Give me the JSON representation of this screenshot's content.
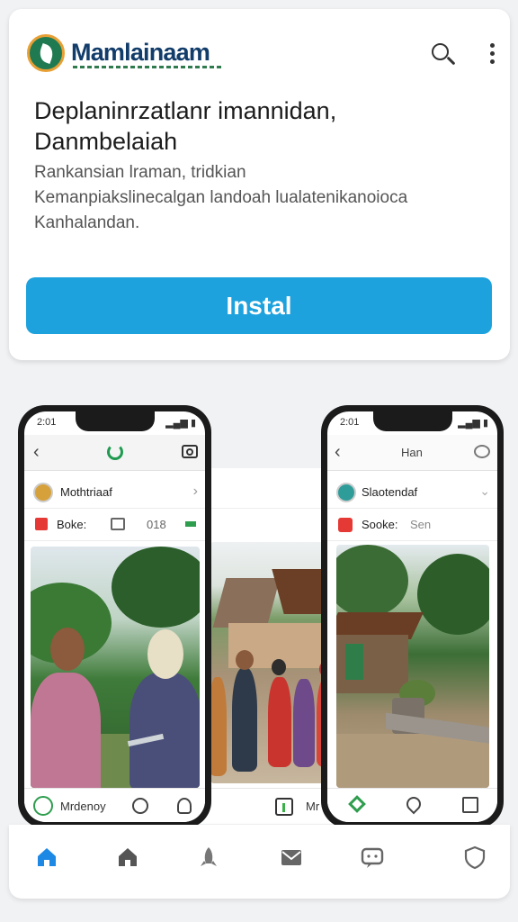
{
  "header": {
    "brand": "Mamlainaam",
    "title_line1": "Deplaninrzatlanr imannidan,",
    "title_line2": "Danmbelaiah",
    "desc_line1": "Rankansian lraman, tridkian",
    "desc_line2": "Kemanpiakslinecalgan landoah lualatenikanoioca",
    "desc_line3": "Kanhalandan.",
    "install_label": "Instal"
  },
  "screenshots": {
    "left": {
      "time": "2:01",
      "profile_name": "Mothtriaaf",
      "row_label": "Boke:",
      "row_value": "018",
      "footer_name": "Mrdenoy"
    },
    "right": {
      "time": "2:01",
      "bar_title": "Han",
      "profile_name": "Slaotendaf",
      "row_label": "Sooke:",
      "row_value": "Sen"
    },
    "middle": {
      "footer_label": "Mr"
    }
  },
  "colors": {
    "accent": "#1ea2dd",
    "brand_navy": "#123c6a",
    "brand_green": "#1f7a52",
    "active_tab": "#1e88e5"
  },
  "icons": [
    "search-icon",
    "more-vert-icon",
    "home-icon",
    "home-outline-icon",
    "rocket-icon",
    "mail-icon",
    "chat-icon",
    "shield-icon"
  ]
}
